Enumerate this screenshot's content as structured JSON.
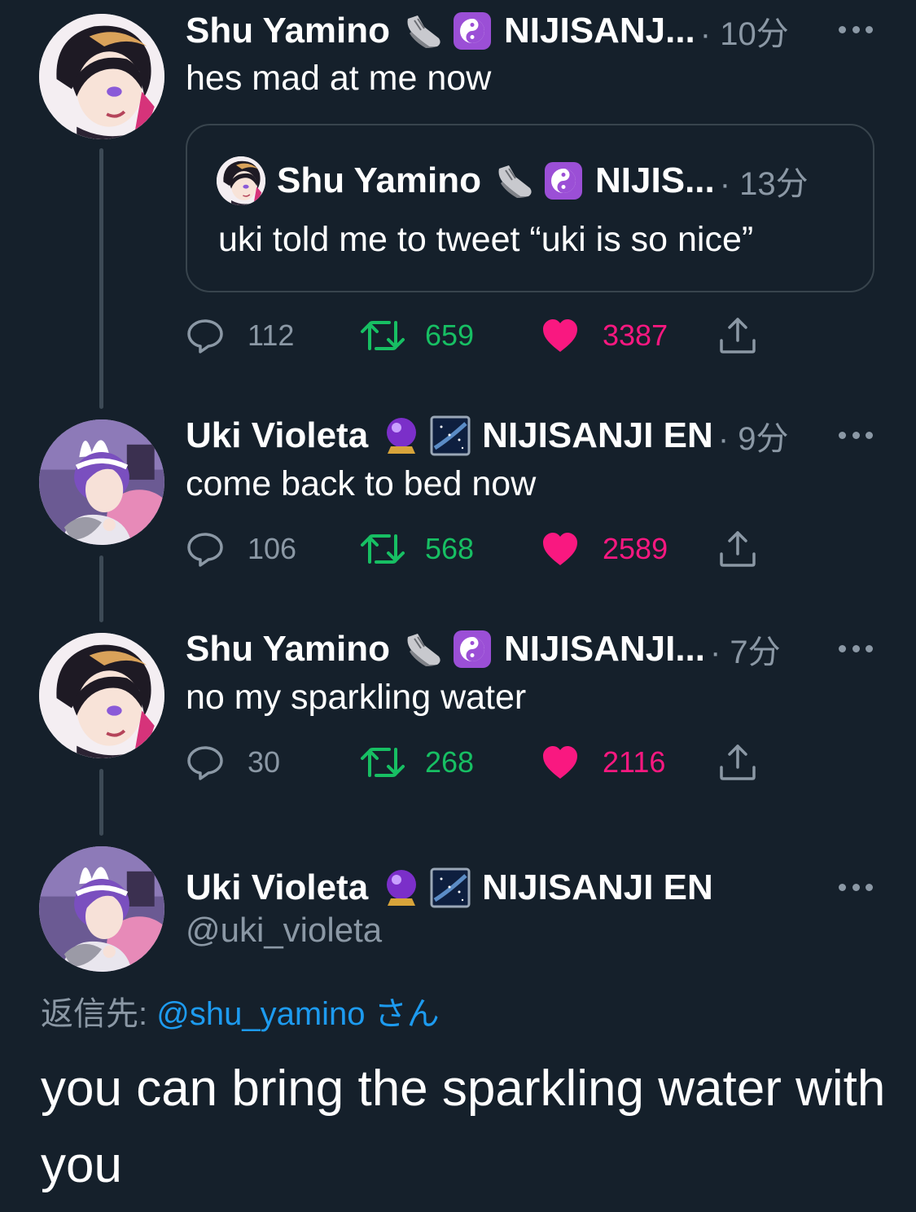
{
  "tweets": [
    {
      "name": "Shu Yamino",
      "emoji1": "sneaker-emoji",
      "emoji2": "yin-yang-emoji",
      "org": "NIJISANJ...",
      "time": "· 10分",
      "text": "hes mad at me now",
      "quote": {
        "name": "Shu Yamino",
        "emoji1": "sneaker-emoji",
        "emoji2": "yin-yang-emoji",
        "org": "NIJIS...",
        "time": "· 13分",
        "text": "uki told me to tweet “uki is so nice”"
      },
      "stats": {
        "replies": "112",
        "retweets": "659",
        "likes": "3387"
      }
    },
    {
      "name": "Uki Violeta",
      "emoji1": "crystal-ball-emoji",
      "emoji2": "milky-way-emoji",
      "org": "NIJISANJI EN",
      "time": "· 9分",
      "text": "come back to bed now",
      "stats": {
        "replies": "106",
        "retweets": "568",
        "likes": "2589"
      }
    },
    {
      "name": "Shu Yamino",
      "emoji1": "sneaker-emoji",
      "emoji2": "yin-yang-emoji",
      "org": "NIJISANJI...",
      "time": "· 7分",
      "text": "no my sparkling water",
      "stats": {
        "replies": "30",
        "retweets": "268",
        "likes": "2116"
      }
    }
  ],
  "main": {
    "name": "Uki Violeta",
    "emoji1": "crystal-ball-emoji",
    "emoji2": "milky-way-emoji",
    "org": "NIJISANJI EN",
    "handle": "@uki_violeta",
    "reply_prefix": "返信先: ",
    "reply_mention": "@shu_yamino",
    "reply_suffix": " さん",
    "text": "you can bring the sparkling water with you"
  },
  "colors": {
    "background": "#15202b",
    "secondary_text": "#8b98a5",
    "retweet": "#17bf63",
    "like": "#f91880",
    "link": "#1d9bf0"
  },
  "icons": [
    "reply-icon",
    "retweet-icon",
    "like-icon",
    "share-icon",
    "more-icon"
  ]
}
